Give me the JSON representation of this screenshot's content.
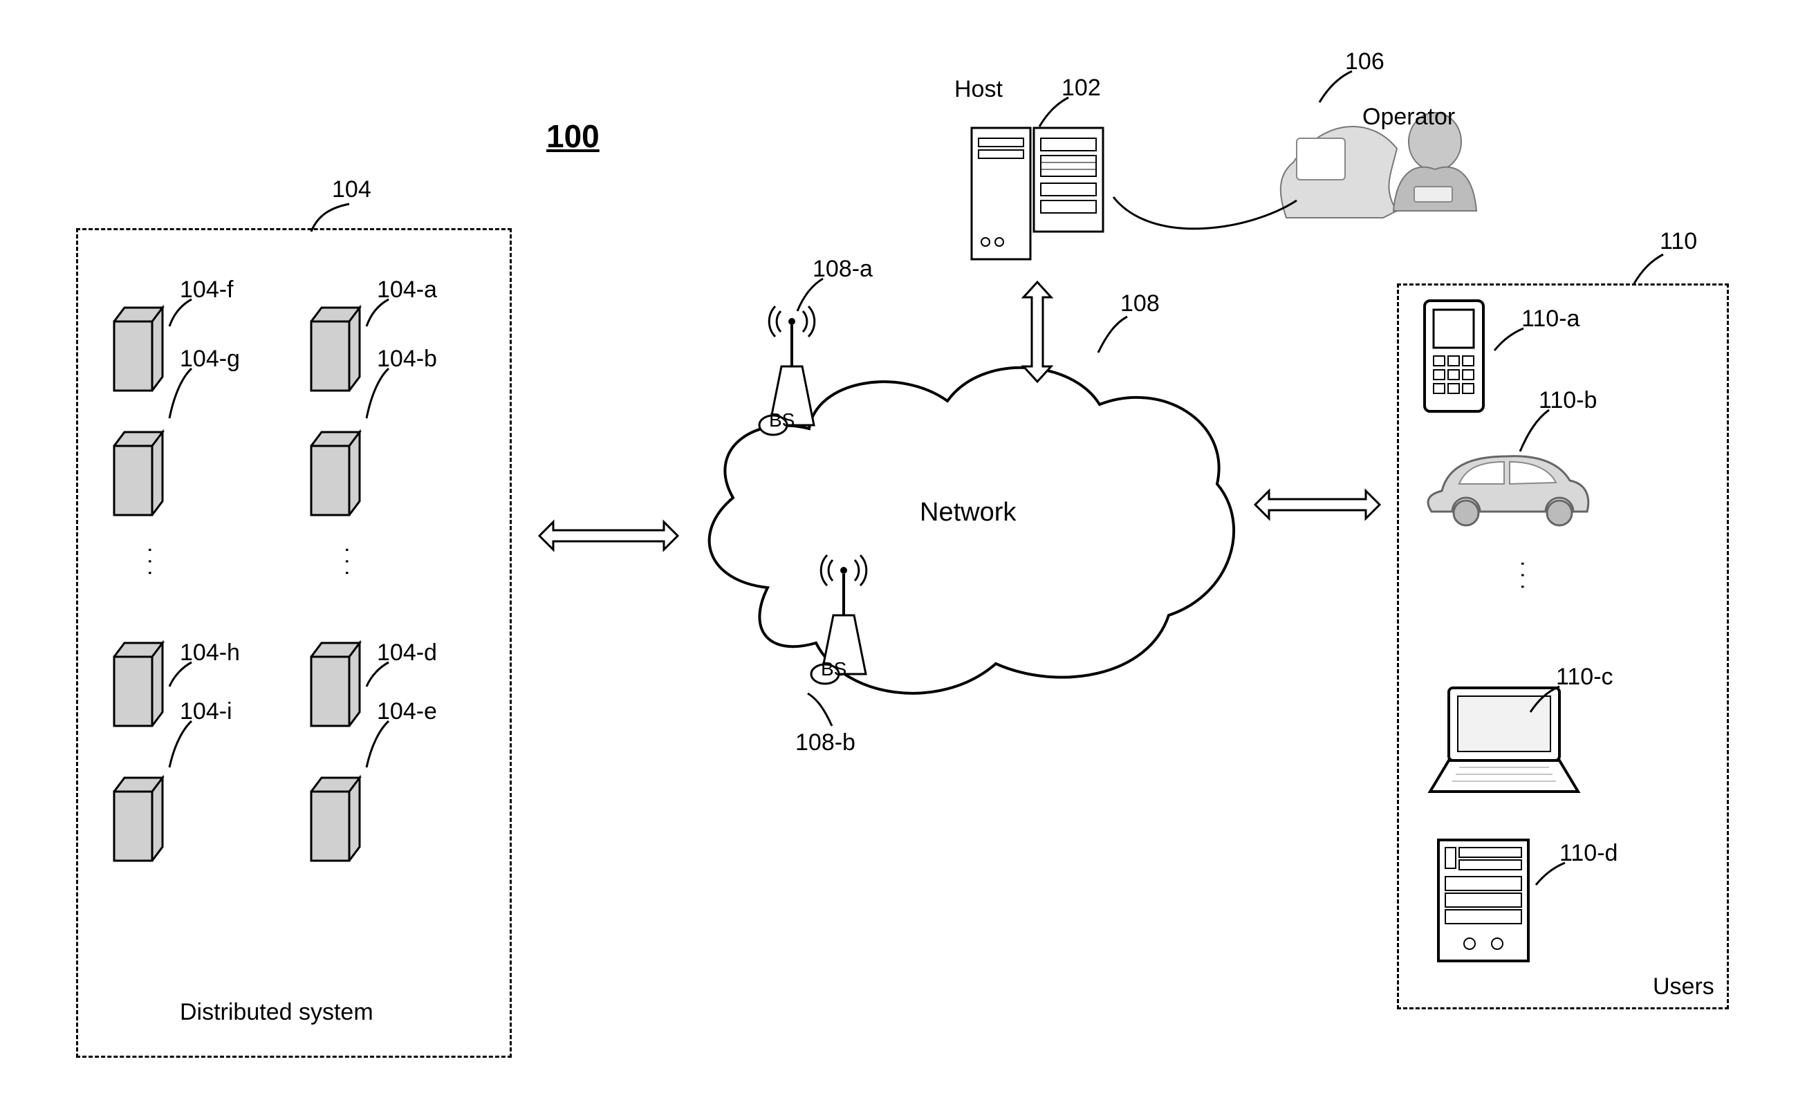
{
  "figure_number": "100",
  "host_label": "Host",
  "host_ref": "102",
  "operator_label": "Operator",
  "operator_ref": "106",
  "network_label": "Network",
  "network_ref": "108",
  "bs_label": "BS",
  "bs_a_ref": "108-a",
  "bs_b_ref": "108-b",
  "dist_box_ref": "104",
  "dist_box_label": "Distributed system",
  "nodes": {
    "a": "104-a",
    "b": "104-b",
    "d": "104-d",
    "e": "104-e",
    "f": "104-f",
    "g": "104-g",
    "h": "104-h",
    "i": "104-i"
  },
  "users_box_ref": "110",
  "users_box_label": "Users",
  "users": {
    "a": "110-a",
    "b": "110-b",
    "c": "110-c",
    "d": "110-d"
  }
}
